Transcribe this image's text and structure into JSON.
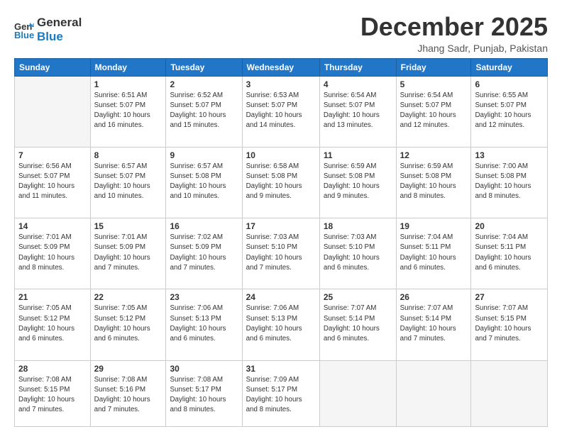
{
  "header": {
    "logo_line1": "General",
    "logo_line2": "Blue",
    "month_title": "December 2025",
    "location": "Jhang Sadr, Punjab, Pakistan"
  },
  "weekdays": [
    "Sunday",
    "Monday",
    "Tuesday",
    "Wednesday",
    "Thursday",
    "Friday",
    "Saturday"
  ],
  "weeks": [
    [
      {
        "day": "",
        "info": ""
      },
      {
        "day": "1",
        "info": "Sunrise: 6:51 AM\nSunset: 5:07 PM\nDaylight: 10 hours\nand 16 minutes."
      },
      {
        "day": "2",
        "info": "Sunrise: 6:52 AM\nSunset: 5:07 PM\nDaylight: 10 hours\nand 15 minutes."
      },
      {
        "day": "3",
        "info": "Sunrise: 6:53 AM\nSunset: 5:07 PM\nDaylight: 10 hours\nand 14 minutes."
      },
      {
        "day": "4",
        "info": "Sunrise: 6:54 AM\nSunset: 5:07 PM\nDaylight: 10 hours\nand 13 minutes."
      },
      {
        "day": "5",
        "info": "Sunrise: 6:54 AM\nSunset: 5:07 PM\nDaylight: 10 hours\nand 12 minutes."
      },
      {
        "day": "6",
        "info": "Sunrise: 6:55 AM\nSunset: 5:07 PM\nDaylight: 10 hours\nand 12 minutes."
      }
    ],
    [
      {
        "day": "7",
        "info": "Sunrise: 6:56 AM\nSunset: 5:07 PM\nDaylight: 10 hours\nand 11 minutes."
      },
      {
        "day": "8",
        "info": "Sunrise: 6:57 AM\nSunset: 5:07 PM\nDaylight: 10 hours\nand 10 minutes."
      },
      {
        "day": "9",
        "info": "Sunrise: 6:57 AM\nSunset: 5:08 PM\nDaylight: 10 hours\nand 10 minutes."
      },
      {
        "day": "10",
        "info": "Sunrise: 6:58 AM\nSunset: 5:08 PM\nDaylight: 10 hours\nand 9 minutes."
      },
      {
        "day": "11",
        "info": "Sunrise: 6:59 AM\nSunset: 5:08 PM\nDaylight: 10 hours\nand 9 minutes."
      },
      {
        "day": "12",
        "info": "Sunrise: 6:59 AM\nSunset: 5:08 PM\nDaylight: 10 hours\nand 8 minutes."
      },
      {
        "day": "13",
        "info": "Sunrise: 7:00 AM\nSunset: 5:08 PM\nDaylight: 10 hours\nand 8 minutes."
      }
    ],
    [
      {
        "day": "14",
        "info": "Sunrise: 7:01 AM\nSunset: 5:09 PM\nDaylight: 10 hours\nand 8 minutes."
      },
      {
        "day": "15",
        "info": "Sunrise: 7:01 AM\nSunset: 5:09 PM\nDaylight: 10 hours\nand 7 minutes."
      },
      {
        "day": "16",
        "info": "Sunrise: 7:02 AM\nSunset: 5:09 PM\nDaylight: 10 hours\nand 7 minutes."
      },
      {
        "day": "17",
        "info": "Sunrise: 7:03 AM\nSunset: 5:10 PM\nDaylight: 10 hours\nand 7 minutes."
      },
      {
        "day": "18",
        "info": "Sunrise: 7:03 AM\nSunset: 5:10 PM\nDaylight: 10 hours\nand 6 minutes."
      },
      {
        "day": "19",
        "info": "Sunrise: 7:04 AM\nSunset: 5:11 PM\nDaylight: 10 hours\nand 6 minutes."
      },
      {
        "day": "20",
        "info": "Sunrise: 7:04 AM\nSunset: 5:11 PM\nDaylight: 10 hours\nand 6 minutes."
      }
    ],
    [
      {
        "day": "21",
        "info": "Sunrise: 7:05 AM\nSunset: 5:12 PM\nDaylight: 10 hours\nand 6 minutes."
      },
      {
        "day": "22",
        "info": "Sunrise: 7:05 AM\nSunset: 5:12 PM\nDaylight: 10 hours\nand 6 minutes."
      },
      {
        "day": "23",
        "info": "Sunrise: 7:06 AM\nSunset: 5:13 PM\nDaylight: 10 hours\nand 6 minutes."
      },
      {
        "day": "24",
        "info": "Sunrise: 7:06 AM\nSunset: 5:13 PM\nDaylight: 10 hours\nand 6 minutes."
      },
      {
        "day": "25",
        "info": "Sunrise: 7:07 AM\nSunset: 5:14 PM\nDaylight: 10 hours\nand 6 minutes."
      },
      {
        "day": "26",
        "info": "Sunrise: 7:07 AM\nSunset: 5:14 PM\nDaylight: 10 hours\nand 7 minutes."
      },
      {
        "day": "27",
        "info": "Sunrise: 7:07 AM\nSunset: 5:15 PM\nDaylight: 10 hours\nand 7 minutes."
      }
    ],
    [
      {
        "day": "28",
        "info": "Sunrise: 7:08 AM\nSunset: 5:15 PM\nDaylight: 10 hours\nand 7 minutes."
      },
      {
        "day": "29",
        "info": "Sunrise: 7:08 AM\nSunset: 5:16 PM\nDaylight: 10 hours\nand 7 minutes."
      },
      {
        "day": "30",
        "info": "Sunrise: 7:08 AM\nSunset: 5:17 PM\nDaylight: 10 hours\nand 8 minutes."
      },
      {
        "day": "31",
        "info": "Sunrise: 7:09 AM\nSunset: 5:17 PM\nDaylight: 10 hours\nand 8 minutes."
      },
      {
        "day": "",
        "info": ""
      },
      {
        "day": "",
        "info": ""
      },
      {
        "day": "",
        "info": ""
      }
    ]
  ]
}
